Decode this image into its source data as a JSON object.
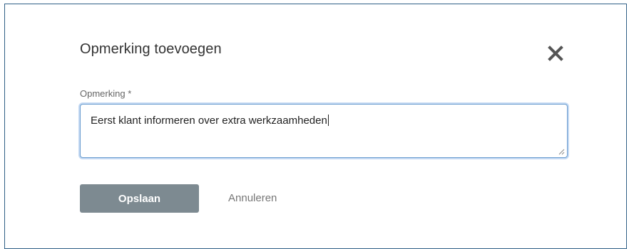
{
  "dialog": {
    "title": "Opmerking toevoegen",
    "close_icon": "close-icon",
    "field": {
      "label": "Opmerking *",
      "value": "Eerst klant informeren over extra werkzaamheden"
    },
    "buttons": {
      "save_label": "Opslaan",
      "cancel_label": "Annuleren"
    }
  },
  "colors": {
    "border": "#2f5f86",
    "focus": "#6a9ccf",
    "save_bg": "#7d8a91"
  }
}
